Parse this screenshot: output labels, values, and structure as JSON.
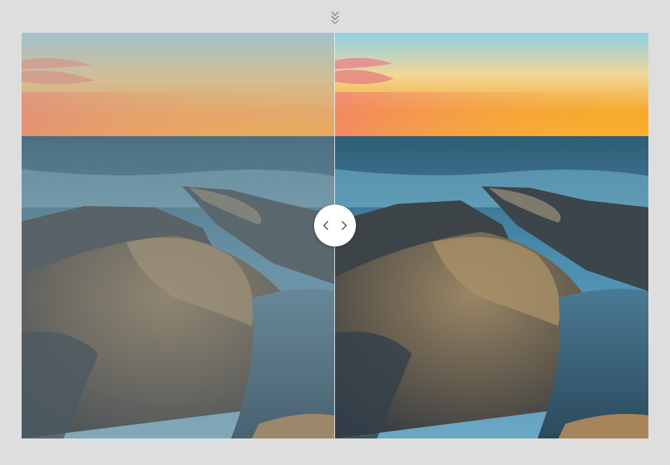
{
  "viewer": {
    "split_position": 0.5,
    "icons": {
      "scroll": "double-chevron-down-icon",
      "left": "chevron-left-icon",
      "right": "chevron-right-icon"
    },
    "colors": {
      "background": "#dedede",
      "handle": "#ffffff",
      "chevron": "#555555",
      "scroll_icon": "#8a8a8a"
    }
  }
}
